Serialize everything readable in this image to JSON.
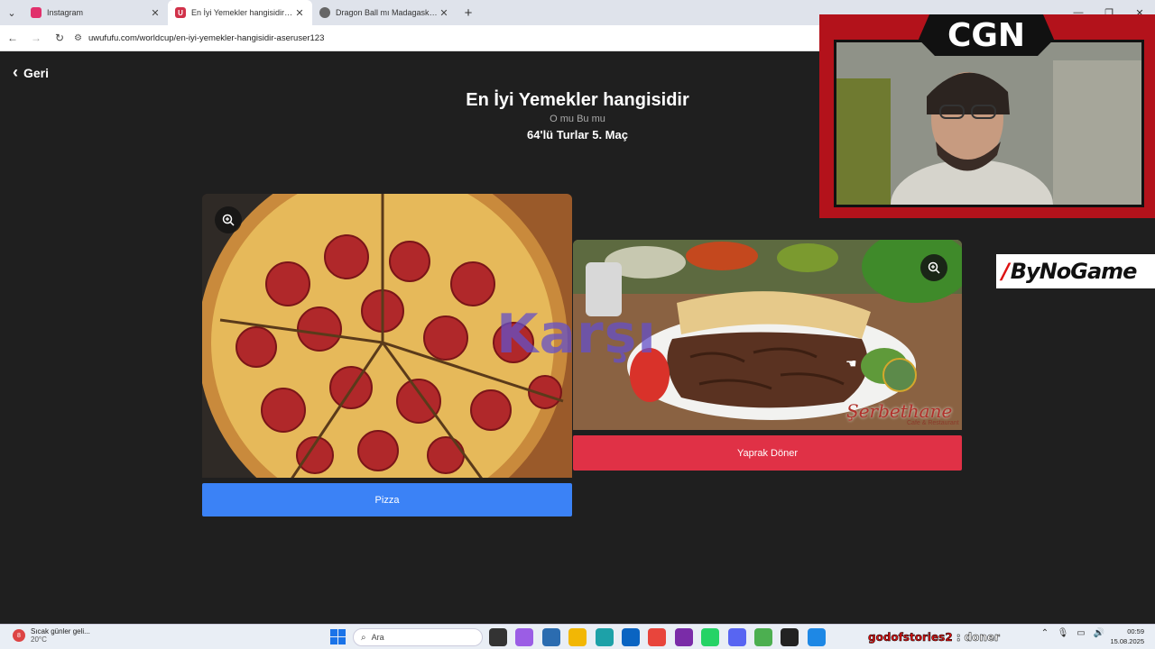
{
  "browser": {
    "tabs": [
      {
        "label": "Instagram",
        "color": "#e1306c",
        "active": false
      },
      {
        "label": "En İyi Yemekler hangisidir | Uw",
        "color": "#d1324a",
        "active": true
      },
      {
        "label": "Dragon Ball mı Madagaskar mı",
        "color": "#555555",
        "active": false
      }
    ],
    "url": "uwufufu.com/worldcup/en-iyi-yemekler-hangisidir-aseruser123"
  },
  "page": {
    "back_label": "Geri",
    "title": "En İyi Yemekler hangisidir",
    "subtitle": "O mu Bu mu",
    "round": "64'lü Turlar 5. Maç",
    "versus": "Karşı",
    "left_choice": {
      "label": "Pizza",
      "color": "#3b82f6"
    },
    "right_choice": {
      "label": "Yaprak Döner",
      "color": "#e03146",
      "watermark": "Şerbethane",
      "watermark_sub": "Cafe & Restaurant"
    }
  },
  "stream": {
    "brand": "CGN",
    "sponsor": "ByNoGame",
    "chat_user": "godofstories2",
    "chat_sep": ":",
    "chat_message": "doner"
  },
  "taskbar": {
    "weather_text": "Sıcak günler geli...",
    "weather_temp": "20°C",
    "weather_badge": "8",
    "search_placeholder": "Ara",
    "time": "00:59",
    "date": "15.08.2025"
  }
}
